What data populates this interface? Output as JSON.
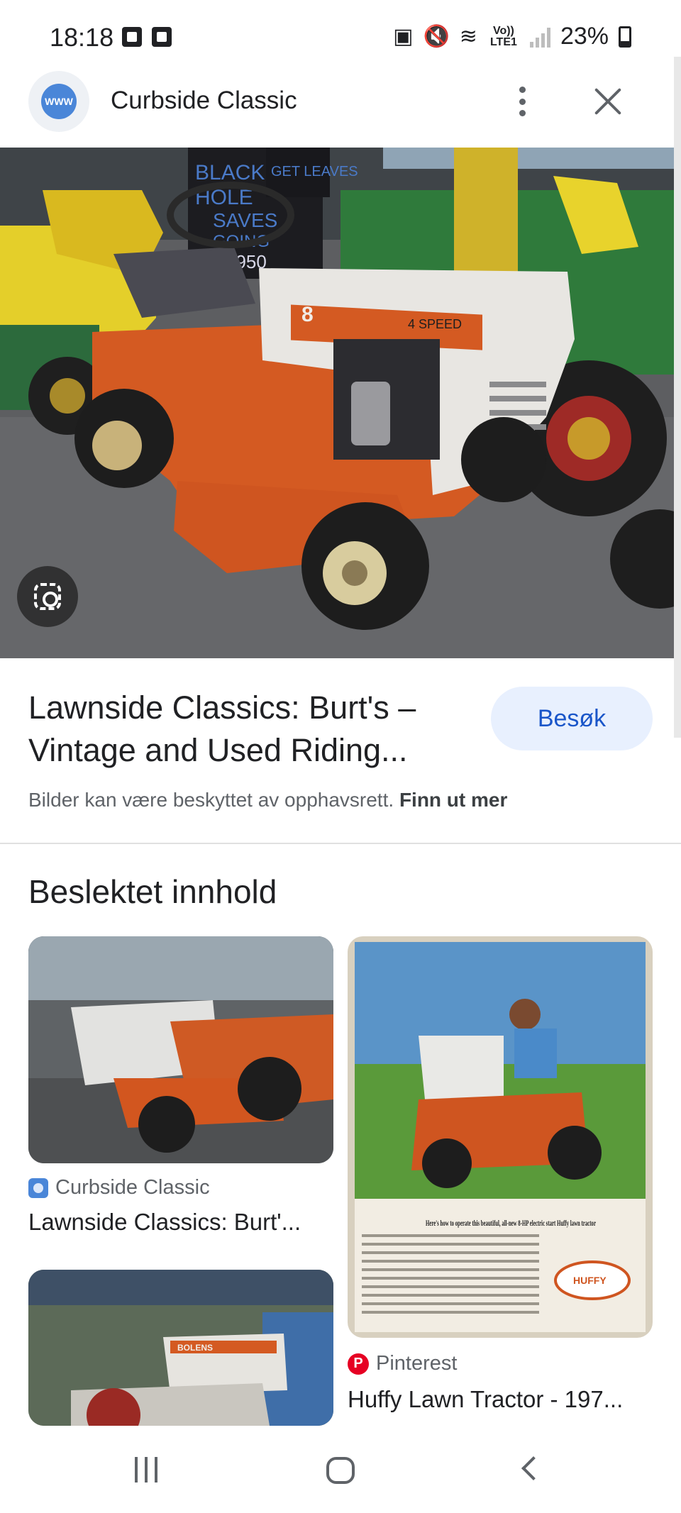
{
  "status_bar": {
    "time": "18:18",
    "network": "Vo)) LTE1",
    "battery": "23%",
    "battery_level": 0.23
  },
  "header": {
    "site_name": "Curbside Classic",
    "favicon_label": "WWW"
  },
  "result": {
    "title": "Lawnside Classics: Burt's – Vintage and Used Riding...",
    "visit_label": "Besøk",
    "copyright_text": "Bilder kan være beskyttet av opphavsrett.",
    "learn_more_label": "Finn ut mer"
  },
  "related": {
    "heading": "Beslektet innhold",
    "items": [
      {
        "source": "Curbside Classic",
        "caption": "Lawnside Classics: Burt'..."
      },
      {
        "source": "Pinterest",
        "caption": "Huffy Lawn Tractor - 197..."
      }
    ]
  },
  "image_text": {
    "sign": [
      "BLACK",
      "HOLE",
      "SAVES",
      "GOING",
      "$950"
    ],
    "sign_right": "GET LEAVES",
    "hood_badge": "8",
    "hood_label": "4 SPEED",
    "ad_headline": "Here's how to operate this beautiful, all-new 8-HP electric start Huffy lawn tractor",
    "ad_brand": "HUFFY",
    "card3_label": "BOLENS"
  },
  "colors": {
    "accent": "#1a56c9",
    "visit_bg": "#e8f0fe",
    "pinterest": "#e60023"
  }
}
